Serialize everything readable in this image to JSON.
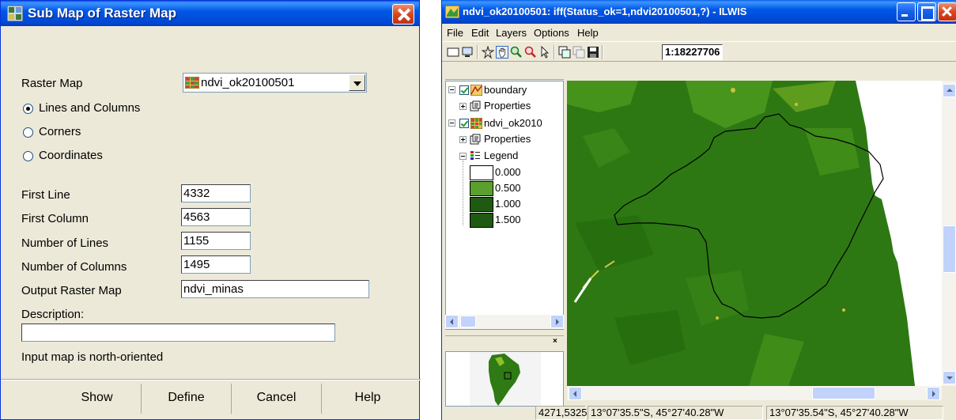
{
  "dialog": {
    "title": "Sub Map of Raster Map",
    "raster_map_label": "Raster Map",
    "raster_map_value": "ndvi_ok20100501",
    "options": [
      "Lines and Columns",
      "Corners",
      "Coordinates"
    ],
    "selected_option": "Lines and Columns",
    "fields": [
      {
        "label": "First Line",
        "value": "4332"
      },
      {
        "label": "First Column",
        "value": "4563"
      },
      {
        "label": "Number of Lines",
        "value": "1155"
      },
      {
        "label": "Number of Columns",
        "value": "1495"
      },
      {
        "label": "Output Raster Map",
        "value": "ndvi_minas"
      }
    ],
    "description_label": "Description:",
    "description_value": "",
    "note": "Input map is north-oriented",
    "buttons": {
      "show": "Show",
      "define": "Define",
      "cancel": "Cancel",
      "help": "Help"
    }
  },
  "window": {
    "title": "ndvi_ok20100501: iff(Status_ok=1,ndvi20100501,?) - ILWIS",
    "menu": [
      "File",
      "Edit",
      "Layers",
      "Options",
      "Help"
    ],
    "scale": "1:18227706",
    "tree": {
      "layer1": "boundary",
      "layer1_props": "Properties",
      "layer2": "ndvi_ok2010",
      "layer2_props": "Properties",
      "legend": "Legend",
      "legend_items": [
        {
          "value": "0.000",
          "color": "#ffffff"
        },
        {
          "value": "0.500",
          "color": "#5aa02c"
        },
        {
          "value": "1.000",
          "color": "#1f5a12"
        },
        {
          "value": "1.500",
          "color": "#1f5a12"
        }
      ]
    },
    "status": {
      "rowcol": "4271,5325",
      "latlon1": "13°07'35.5\"S, 45°27'40.28\"W",
      "latlon2": "13°07'35.54\"S, 45°27'40.28\"W"
    }
  },
  "colors": {
    "titlebar": "#0054e3",
    "dialog_bg": "#ece9d8",
    "map_green": "#2e7a14",
    "map_light": "#8fbf2a"
  }
}
